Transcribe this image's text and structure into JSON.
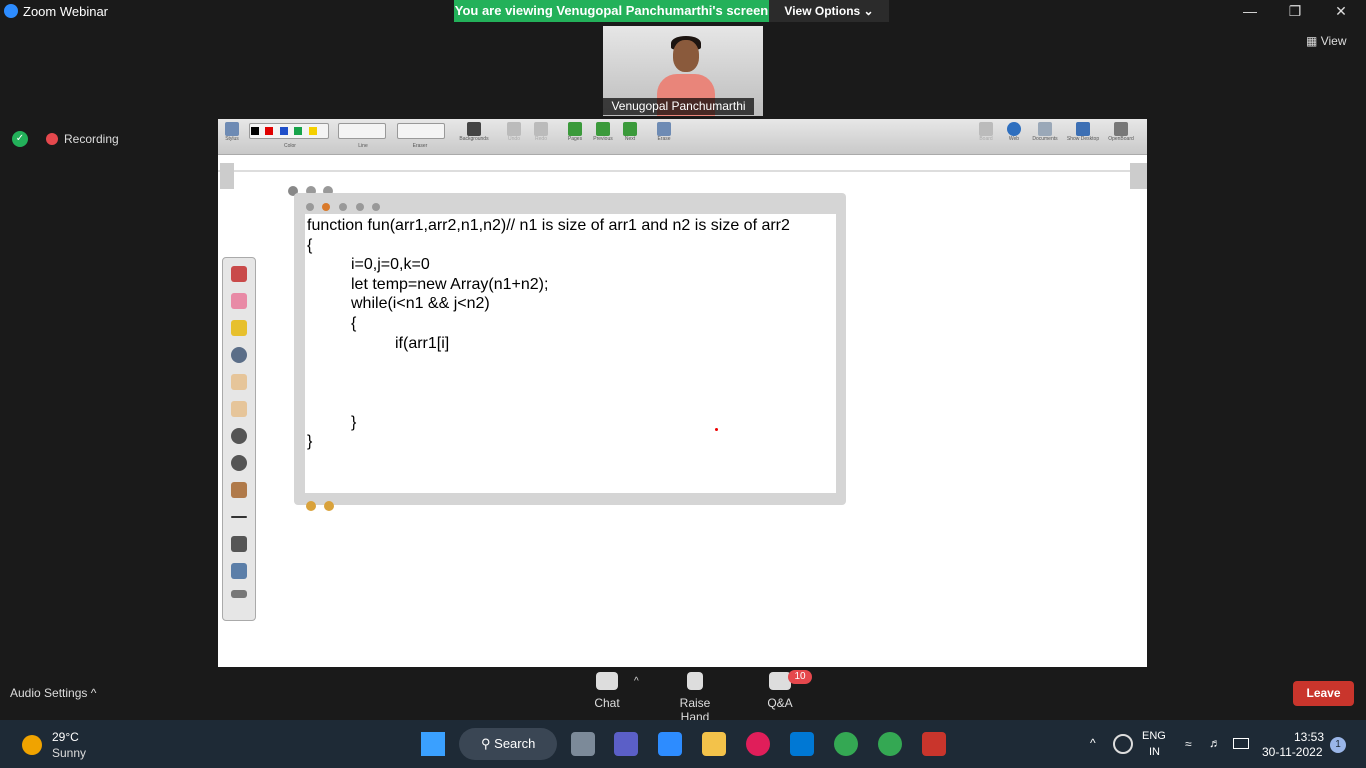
{
  "window": {
    "title": "Zoom Webinar",
    "share_banner": "You are viewing Venugopal Panchumarthi's screen",
    "view_options": "View Options ⌄",
    "view_button": "View"
  },
  "video": {
    "participant_name": "Venugopal Panchumarthi"
  },
  "recording": {
    "label": "Recording"
  },
  "openboard_toolbar": {
    "items": [
      {
        "label": "Stylus"
      },
      {
        "label": "Color"
      },
      {
        "label": "Line"
      },
      {
        "label": "Eraser"
      },
      {
        "label": "Backgrounds"
      },
      {
        "label": "Undo"
      },
      {
        "label": "Redo"
      },
      {
        "label": "Pages"
      },
      {
        "label": "Previous"
      },
      {
        "label": "Next"
      },
      {
        "label": "Erase"
      },
      {
        "label": "Board"
      },
      {
        "label": "Web"
      },
      {
        "label": "Documents"
      },
      {
        "label": "Show Desktop"
      },
      {
        "label": "OpenBoard"
      }
    ],
    "colors": [
      "#000000",
      "#e00000",
      "#1f4fc9",
      "#17a34a",
      "#f5d000"
    ]
  },
  "code_lines": [
    "function fun(arr1,arr2,n1,n2)// n1 is size of arr1 and n2 is size of arr2",
    "{",
    "i=0,j=0,k=0",
    "let temp=new Array(n1+n2);",
    "while(i<n1 && j<n2)",
    "{",
    "if(arr1[i]",
    "}",
    "}"
  ],
  "controls": {
    "audio_settings": "Audio Settings ^",
    "chat": "Chat",
    "raise_hand": "Raise Hand",
    "qa": "Q&A",
    "qa_badge": "10",
    "leave": "Leave"
  },
  "taskbar": {
    "temperature": "29°C",
    "condition": "Sunny",
    "search": "Search",
    "lang_top": "ENG",
    "lang_bottom": "IN",
    "time": "13:53",
    "date": "30-11-2022",
    "notification_count": "1"
  }
}
